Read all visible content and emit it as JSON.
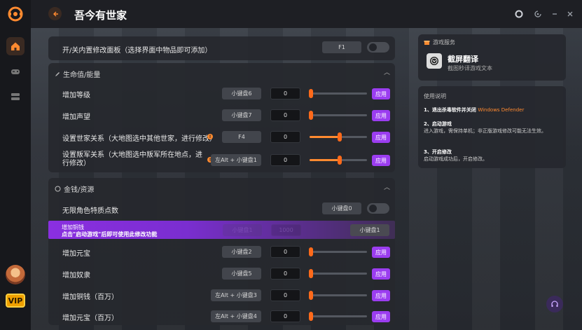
{
  "app": {
    "title": "吾今有世家",
    "vip_label": "VIP"
  },
  "colors": {
    "accent": "#ff8a30",
    "apply": "#9b3df0",
    "bg": "#1c1d22"
  },
  "top_toggle": {
    "label": "开/关内置修改面板（选择界面中物品即可添加）",
    "key": "F1",
    "on": false
  },
  "life_section": {
    "title": "生命值/能量",
    "rows": [
      {
        "label": "增加等级",
        "key": "小键盘6",
        "value": "0",
        "level": 0,
        "apply": "应用"
      },
      {
        "label": "增加声望",
        "key": "小键盘7",
        "value": "0",
        "level": 0,
        "apply": "应用"
      },
      {
        "label": "设置世家关系（大地图选中其他世家，进行修改）",
        "key": "F4",
        "value": "0",
        "level": 0.5,
        "apply": "应用"
      },
      {
        "label": "设置叛军关系（大地图选中叛军所在地点，进行修改）",
        "key": "左Alt + 小键盘1",
        "value": "0",
        "level": 0.5,
        "apply": "应用"
      }
    ]
  },
  "money_section": {
    "title": "金钱/资源",
    "toggle_row": {
      "label": "无限角色特质点数",
      "key": "小键盘0",
      "on": false
    },
    "promo": {
      "label": "增加铜钱",
      "hint": "点击\"启动游戏\"后即可使用此修改功能",
      "faded_key": "小键盘1",
      "faded_value": "1000",
      "key": "小键盘1"
    },
    "rows": [
      {
        "label": "增加元宝",
        "key": "小键盘2",
        "value": "0",
        "level": 0,
        "apply": "应用"
      },
      {
        "label": "增加奴隶",
        "key": "小键盘5",
        "value": "0",
        "level": 0,
        "apply": "应用"
      },
      {
        "label": "增加铜钱（百万）",
        "key": "左Alt + 小键盘3",
        "value": "0",
        "level": 0,
        "apply": "应用"
      },
      {
        "label": "增加元宝（百万）",
        "key": "左Alt + 小键盘4",
        "value": "0",
        "level": 0,
        "apply": "应用"
      }
    ]
  },
  "service": {
    "header": "游戏服务",
    "name": "截屏翻译",
    "desc": "截图秒译游戏文本"
  },
  "instructions": {
    "header": "使用说明",
    "step1_title": "1、退出杀毒软件并关闭",
    "step1_highlight": "Windows Defender",
    "step2_title": "2、启动游戏",
    "step2_text": "进入游戏，需保持单机；非正版游戏修改可能无法生效。",
    "step3_title": "3、开启修改",
    "step3_text": "启动游戏成功后，开启修改。"
  }
}
